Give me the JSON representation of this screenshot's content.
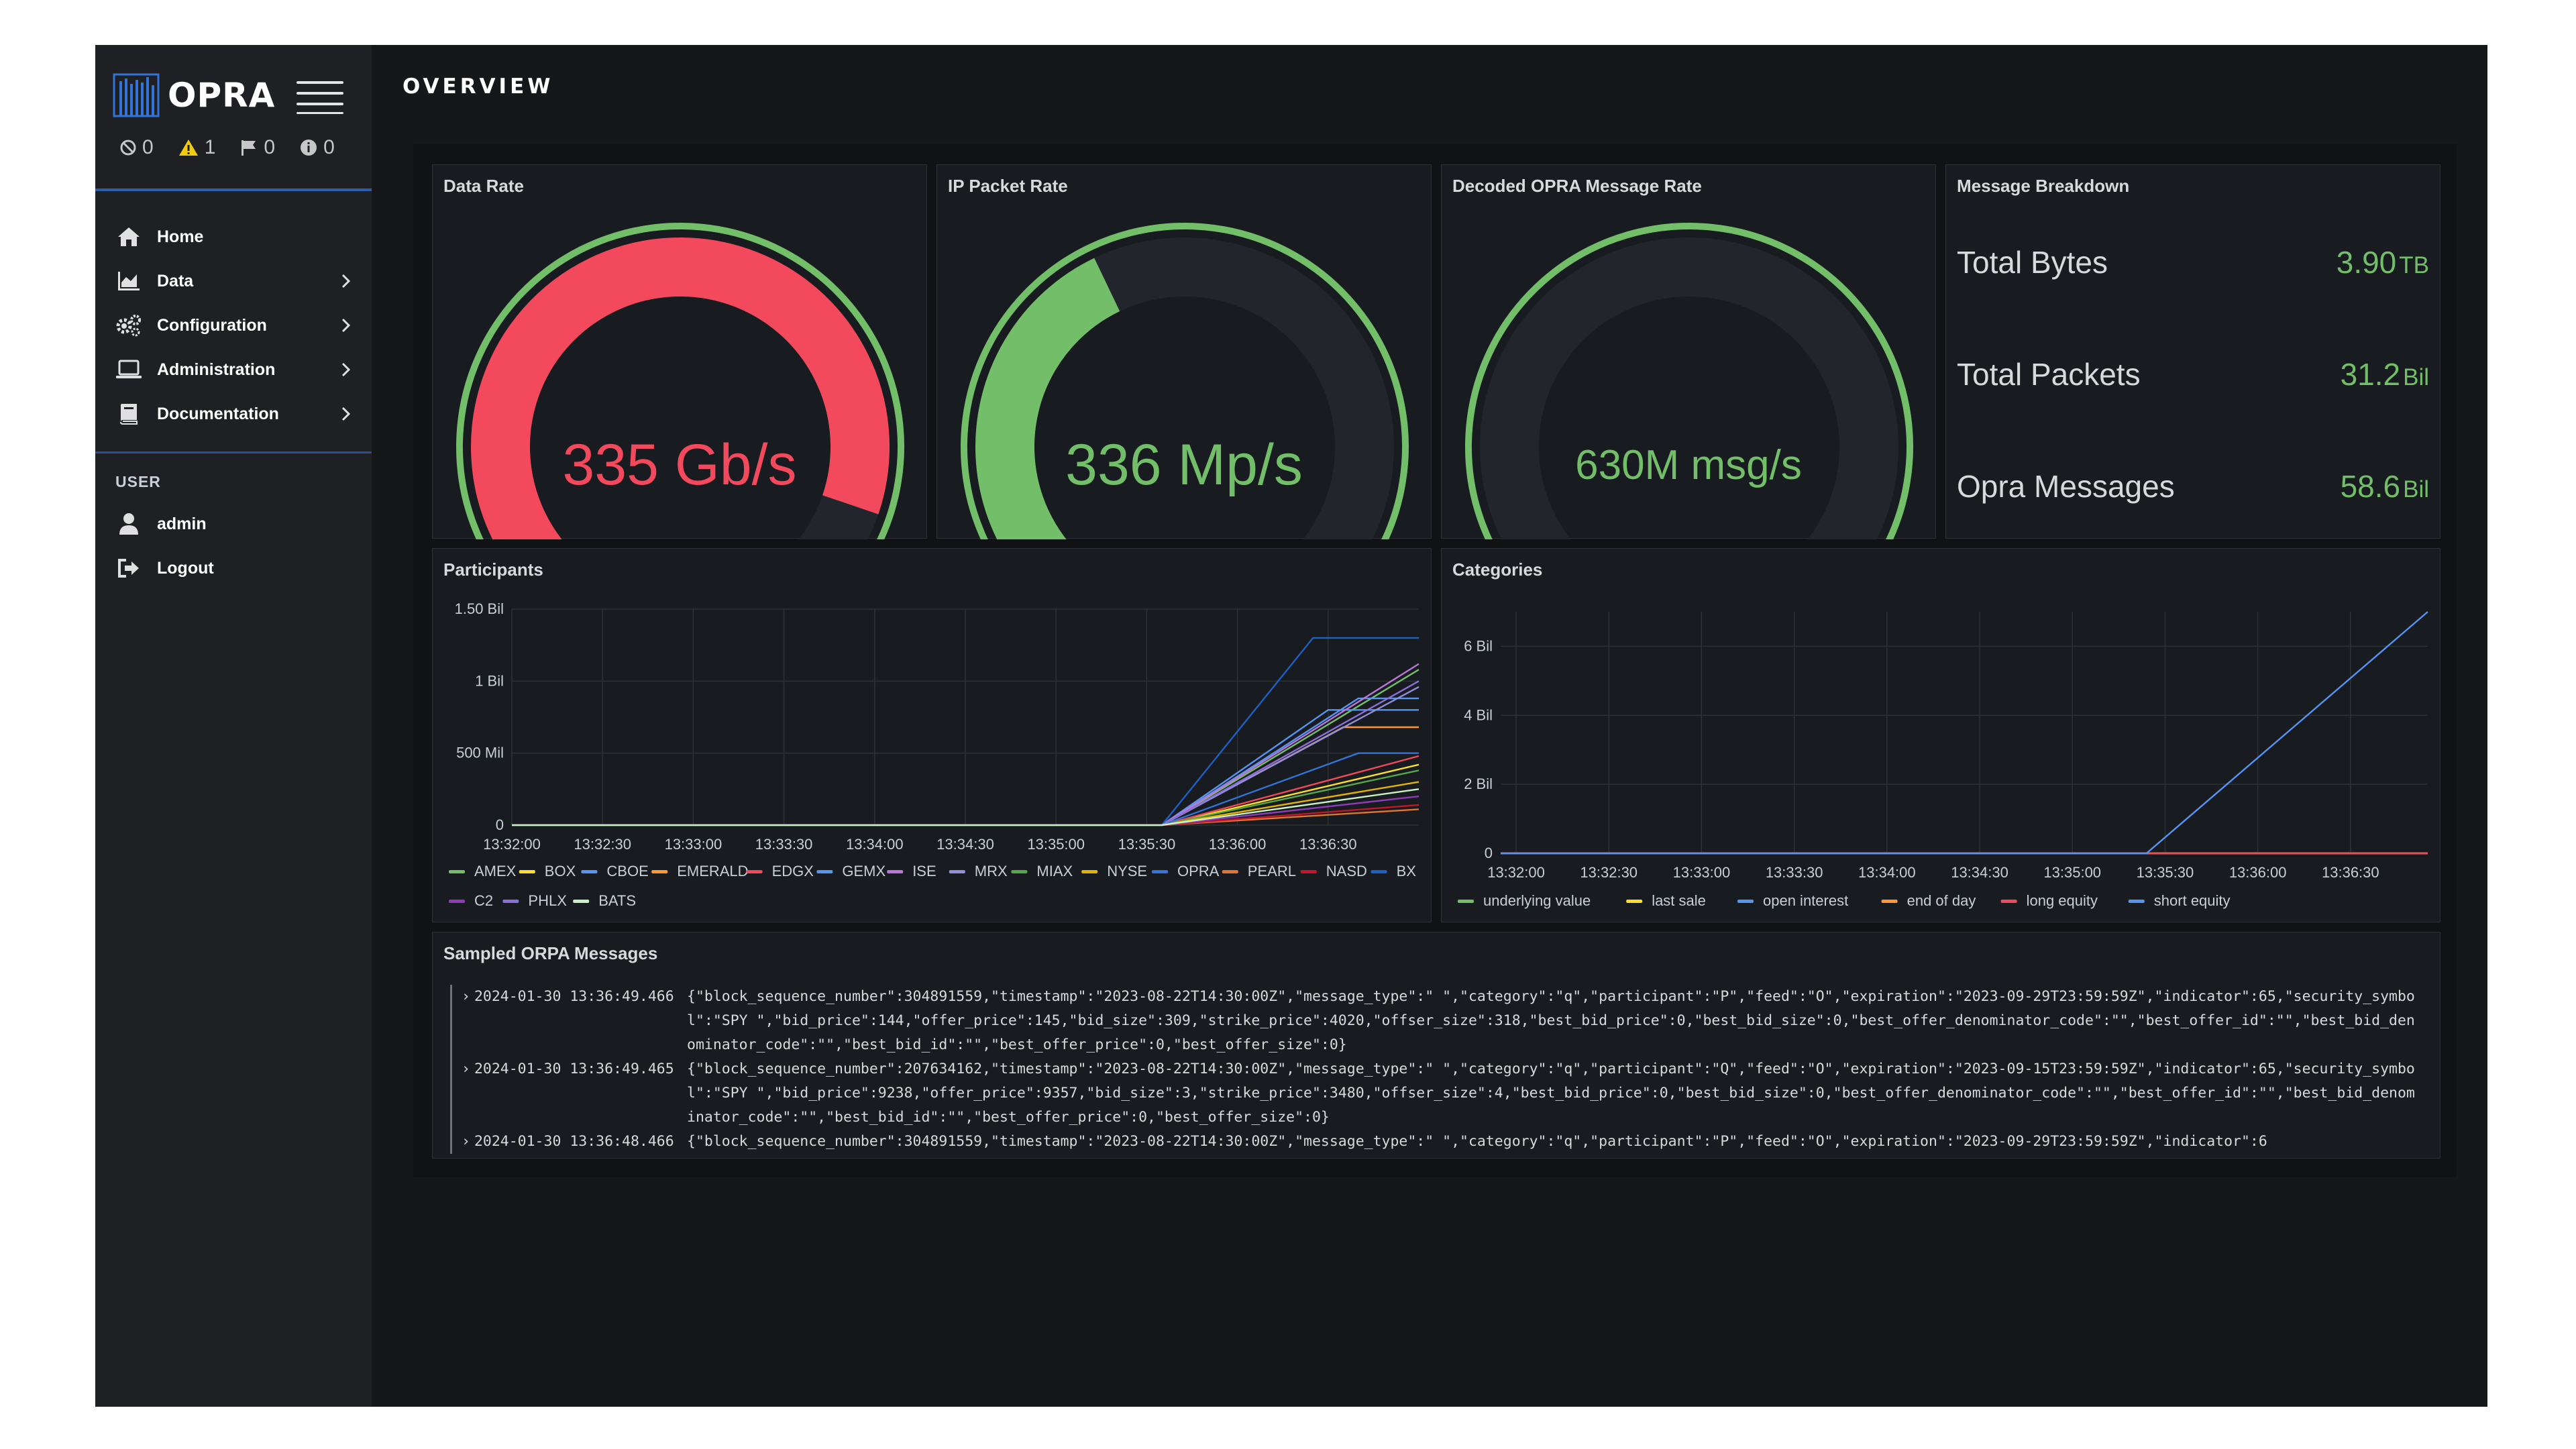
{
  "app": {
    "brand": "OPRA",
    "alerts": [
      {
        "icon": "blocked-icon",
        "count": "0"
      },
      {
        "icon": "warning-icon",
        "count": "1",
        "color": "#f2cc0c"
      },
      {
        "icon": "flag-icon",
        "count": "0"
      },
      {
        "icon": "info-icon",
        "count": "0"
      }
    ]
  },
  "sidebar": {
    "items": [
      {
        "label": "Home",
        "icon": "home-icon"
      },
      {
        "label": "Data",
        "icon": "chart-icon"
      },
      {
        "label": "Configuration",
        "icon": "gears-icon"
      },
      {
        "label": "Administration",
        "icon": "laptop-icon"
      },
      {
        "label": "Documentation",
        "icon": "book-icon"
      }
    ],
    "user_heading": "USER",
    "user_items": [
      {
        "label": "admin",
        "icon": "user-icon"
      },
      {
        "label": "Logout",
        "icon": "logout-icon"
      }
    ]
  },
  "page": {
    "title": "OVERVIEW"
  },
  "panels": {
    "data_rate": {
      "title": "Data Rate",
      "value": "335 Gb/s",
      "fill_fraction": 0.84,
      "color": "#f2495c"
    },
    "ip_packet_rate": {
      "title": "IP Packet Rate",
      "value": "336 Mp/s",
      "fill_fraction": 0.42,
      "color": "#73bf69"
    },
    "decoded_rate": {
      "title": "Decoded OPRA Message Rate",
      "value": "630M msg/s",
      "fill_fraction": 0.0,
      "color": "#73bf69"
    },
    "message_breakdown": {
      "title": "Message Breakdown",
      "rows": [
        {
          "label": "Total Bytes",
          "value": "3.90",
          "unit": "TB"
        },
        {
          "label": "Total Packets",
          "value": "31.2",
          "unit": "Bil"
        },
        {
          "label": "Opra Messages",
          "value": "58.6",
          "unit": "Bil"
        }
      ]
    },
    "participants": {
      "title": "Participants"
    },
    "categories": {
      "title": "Categories"
    },
    "sampled": {
      "title": "Sampled ORPA Messages",
      "entries": [
        {
          "ts": "2024-01-30 13:36:49.466",
          "body": "{\"block_sequence_number\":304891559,\"timestamp\":\"2023-08-22T14:30:00Z\",\"message_type\":\" \",\"category\":\"q\",\"participant\":\"P\",\"feed\":\"O\",\"expiration\":\"2023-09-29T23:59:59Z\",\"indicator\":65,\"security_symbol\":\"SPY \",\"bid_price\":144,\"offer_price\":145,\"bid_size\":309,\"strike_price\":4020,\"offser_size\":318,\"best_bid_price\":0,\"best_bid_size\":0,\"best_offer_denominator_code\":\"\",\"best_offer_id\":\"\",\"best_bid_denominator_code\":\"\",\"best_bid_id\":\"\",\"best_offer_price\":0,\"best_offer_size\":0}"
        },
        {
          "ts": "2024-01-30 13:36:49.465",
          "body": "{\"block_sequence_number\":207634162,\"timestamp\":\"2023-08-22T14:30:00Z\",\"message_type\":\" \",\"category\":\"q\",\"participant\":\"Q\",\"feed\":\"O\",\"expiration\":\"2023-09-15T23:59:59Z\",\"indicator\":65,\"security_symbol\":\"SPY \",\"bid_price\":9238,\"offer_price\":9357,\"bid_size\":3,\"strike_price\":3480,\"offser_size\":4,\"best_bid_price\":0,\"best_bid_size\":0,\"best_offer_denominator_code\":\"\",\"best_offer_id\":\"\",\"best_bid_denominator_code\":\"\",\"best_bid_id\":\"\",\"best_offer_price\":0,\"best_offer_size\":0}"
        },
        {
          "ts": "2024-01-30 13:36:48.466",
          "body": "{\"block_sequence_number\":304891559,\"timestamp\":\"2023-08-22T14:30:00Z\",\"message_type\":\" \",\"category\":\"q\",\"participant\":\"P\",\"feed\":\"O\",\"expiration\":\"2023-09-29T23:59:59Z\",\"indicator\":6"
        }
      ]
    }
  },
  "chart_data": [
    {
      "type": "line",
      "title": "Participants",
      "x": [
        "13:32:00",
        "13:32:30",
        "13:33:00",
        "13:33:30",
        "13:34:00",
        "13:34:30",
        "13:35:00",
        "13:35:30",
        "13:36:00",
        "13:36:30"
      ],
      "y_ticks": [
        "0",
        "500 Mil",
        "1 Bil",
        "1.50 Bil"
      ],
      "ylim": [
        0,
        1500000000
      ],
      "x_range_seconds": [
        0,
        300
      ],
      "series": [
        {
          "name": "AMEX",
          "color": "#73bf69",
          "points": [
            [
              0,
              0
            ],
            [
              215,
              0
            ],
            [
              300,
              1080000000
            ]
          ]
        },
        {
          "name": "BOX",
          "color": "#fade2a",
          "points": [
            [
              0,
              0
            ],
            [
              215,
              0
            ],
            [
              300,
              420000000
            ]
          ]
        },
        {
          "name": "CBOE",
          "color": "#5794f2",
          "points": [
            [
              0,
              0
            ],
            [
              215,
              0
            ],
            [
              270,
              800000000
            ],
            [
              300,
              800000000
            ]
          ]
        },
        {
          "name": "EMERALD",
          "color": "#ff9830",
          "points": [
            [
              0,
              0
            ],
            [
              215,
              0
            ],
            [
              275,
              680000000
            ],
            [
              300,
              680000000
            ]
          ]
        },
        {
          "name": "EDGX",
          "color": "#f2495c",
          "points": [
            [
              0,
              0
            ],
            [
              215,
              0
            ],
            [
              300,
              480000000
            ]
          ]
        },
        {
          "name": "GEMX",
          "color": "#5794f2",
          "points": [
            [
              0,
              0
            ],
            [
              215,
              0
            ],
            [
              280,
              880000000
            ],
            [
              300,
              880000000
            ]
          ]
        },
        {
          "name": "ISE",
          "color": "#b877d9",
          "points": [
            [
              0,
              0
            ],
            [
              215,
              0
            ],
            [
              300,
              1120000000
            ]
          ]
        },
        {
          "name": "MRX",
          "color": "#8f8fdb",
          "points": [
            [
              0,
              0
            ],
            [
              215,
              0
            ],
            [
              300,
              960000000
            ]
          ]
        },
        {
          "name": "MIAX",
          "color": "#56a64b",
          "points": [
            [
              0,
              0
            ],
            [
              215,
              0
            ],
            [
              300,
              380000000
            ]
          ]
        },
        {
          "name": "NYSE",
          "color": "#e0b400",
          "points": [
            [
              0,
              0
            ],
            [
              215,
              0
            ],
            [
              300,
              300000000
            ]
          ]
        },
        {
          "name": "OPRA",
          "color": "#3274d9",
          "points": [
            [
              0,
              0
            ],
            [
              215,
              0
            ],
            [
              280,
              500000000
            ],
            [
              300,
              500000000
            ]
          ]
        },
        {
          "name": "PEARL",
          "color": "#e0752d",
          "points": [
            [
              0,
              0
            ],
            [
              215,
              0
            ],
            [
              300,
              110000000
            ]
          ]
        },
        {
          "name": "NASD",
          "color": "#c4162a",
          "points": [
            [
              0,
              0
            ],
            [
              215,
              0
            ],
            [
              300,
              140000000
            ]
          ]
        },
        {
          "name": "BX",
          "color": "#1f60c4",
          "points": [
            [
              0,
              0
            ],
            [
              215,
              0
            ],
            [
              265,
              1300000000
            ],
            [
              300,
              1300000000
            ]
          ]
        },
        {
          "name": "C2",
          "color": "#8f3bb8",
          "points": [
            [
              0,
              0
            ],
            [
              215,
              0
            ],
            [
              300,
              200000000
            ]
          ]
        },
        {
          "name": "PHLX",
          "color": "#8a6fd8",
          "points": [
            [
              0,
              0
            ],
            [
              215,
              0
            ],
            [
              300,
              1000000000
            ]
          ]
        },
        {
          "name": "BATS",
          "color": "#c8f2c2",
          "points": [
            [
              0,
              0
            ],
            [
              215,
              0
            ],
            [
              300,
              250000000
            ]
          ]
        }
      ]
    },
    {
      "type": "line",
      "title": "Categories",
      "x": [
        "13:32:00",
        "13:32:30",
        "13:33:00",
        "13:33:30",
        "13:34:00",
        "13:34:30",
        "13:35:00",
        "13:35:30",
        "13:36:00",
        "13:36:30"
      ],
      "y_ticks": [
        "0",
        "2 Bil",
        "4 Bil",
        "6 Bil"
      ],
      "ylim": [
        0,
        7000000000
      ],
      "x_range_seconds": [
        -5,
        295
      ],
      "series": [
        {
          "name": "underlying value",
          "color": "#73bf69",
          "points": [
            [
              -5,
              0
            ],
            [
              295,
              0
            ]
          ]
        },
        {
          "name": "last sale",
          "color": "#fade2a",
          "points": [
            [
              -5,
              0
            ],
            [
              295,
              0
            ]
          ]
        },
        {
          "name": "open interest",
          "color": "#5794f2",
          "points": [
            [
              -5,
              0
            ],
            [
              295,
              0
            ]
          ]
        },
        {
          "name": "end of day",
          "color": "#ff9830",
          "points": [
            [
              -5,
              0
            ],
            [
              295,
              0
            ]
          ]
        },
        {
          "name": "long equity",
          "color": "#f2495c",
          "points": [
            [
              -5,
              0
            ],
            [
              295,
              0
            ]
          ]
        },
        {
          "name": "short equity",
          "color": "#5794f2",
          "points": [
            [
              -5,
              0
            ],
            [
              204,
              0
            ],
            [
              295,
              7000000000
            ]
          ]
        }
      ]
    }
  ]
}
